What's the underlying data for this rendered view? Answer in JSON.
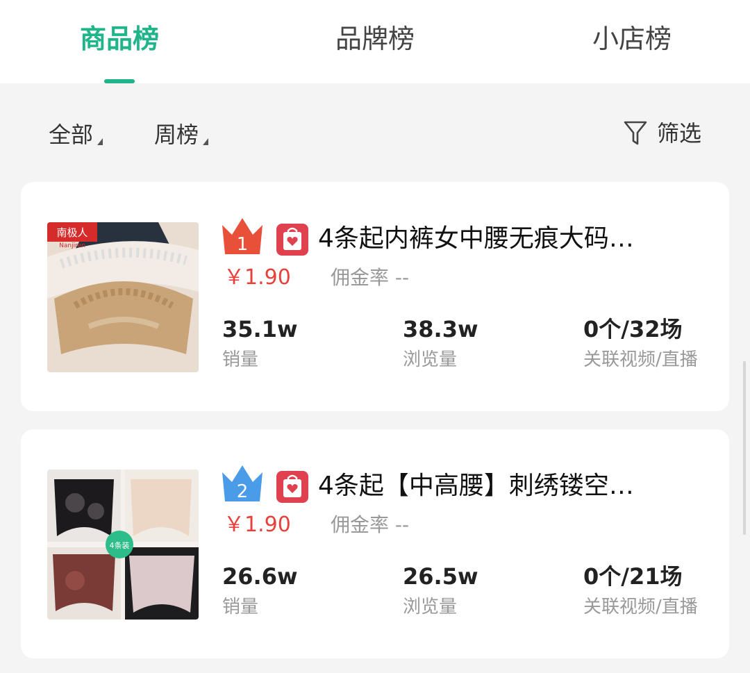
{
  "tabs": [
    {
      "label": "商品榜",
      "active": true
    },
    {
      "label": "品牌榜",
      "active": false
    },
    {
      "label": "小店榜",
      "active": false
    }
  ],
  "filters": {
    "category": "全部",
    "period": "周榜",
    "filter_label": "筛选"
  },
  "colors": {
    "accent": "#1fb48a",
    "price": "#e8413c",
    "rank1": "#e8503a",
    "rank2": "#4a9be8",
    "bag": "#e0414e"
  },
  "products": [
    {
      "rank": "1",
      "title": "4条起内裤女中腰无痕大码…",
      "price": "￥1.90",
      "commission_label": "佣金率",
      "commission_value": "--",
      "stats": [
        {
          "value": "35.1w",
          "label": "销量"
        },
        {
          "value": "38.3w",
          "label": "浏览量"
        },
        {
          "value": "0个/32场",
          "label": "关联视频/直播"
        }
      ],
      "image_text": "南极人",
      "image_subtext": "Nanjiren"
    },
    {
      "rank": "2",
      "title": "4条起【中高腰】刺绣镂空…",
      "price": "￥1.90",
      "commission_label": "佣金率",
      "commission_value": "--",
      "stats": [
        {
          "value": "26.6w",
          "label": "销量"
        },
        {
          "value": "26.5w",
          "label": "浏览量"
        },
        {
          "value": "0个/21场",
          "label": "关联视频/直播"
        }
      ],
      "image_badge": "4条装"
    }
  ]
}
